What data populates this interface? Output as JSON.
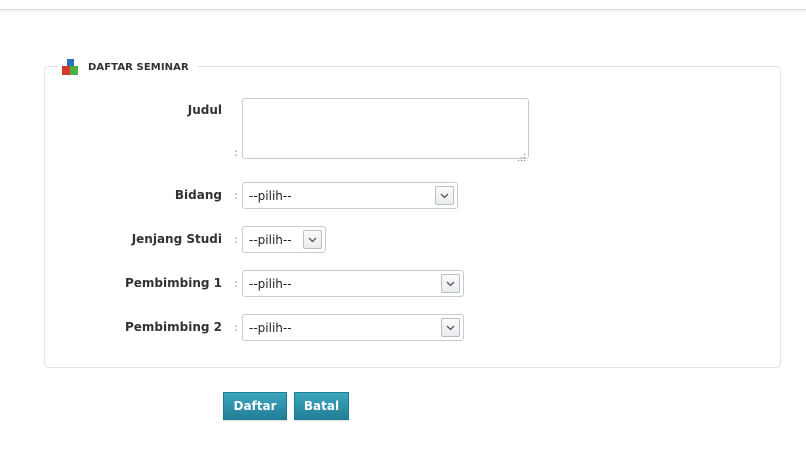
{
  "section": {
    "title": "DAFTAR SEMINAR",
    "icon": "blocks-icon"
  },
  "form": {
    "separator": ":",
    "judul": {
      "label": "Judul",
      "value": ""
    },
    "bidang": {
      "label": "Bidang",
      "selected": "--pilih--"
    },
    "jenjang_studi": {
      "label": "Jenjang Studi",
      "selected": "--pilih--"
    },
    "pembimbing1": {
      "label": "Pembimbing 1",
      "selected": "--pilih--"
    },
    "pembimbing2": {
      "label": "Pembimbing 2",
      "selected": "--pilih--"
    }
  },
  "actions": {
    "submit_label": "Daftar",
    "cancel_label": "Batal"
  },
  "colors": {
    "button": "#2a8aa3",
    "border": "#dfe3e6",
    "icon_blue": "#2a6fbd",
    "icon_red": "#d33a2c",
    "icon_green": "#4caf3f"
  }
}
